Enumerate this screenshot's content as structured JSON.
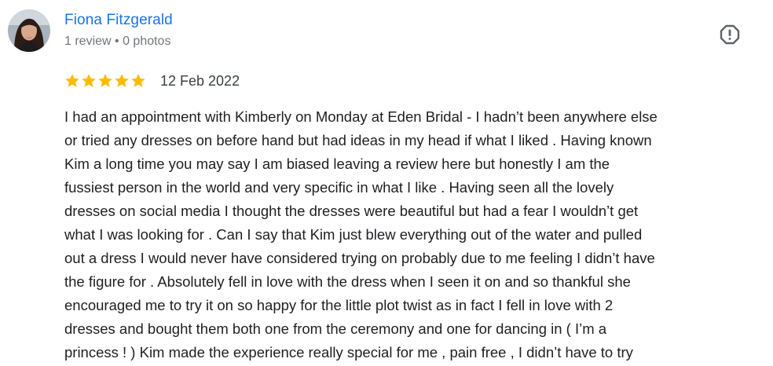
{
  "reviewer": {
    "name": "Fiona Fitzgerald",
    "meta": "1 review • 0 photos"
  },
  "review": {
    "rating": 5,
    "rating_max": 5,
    "date": "12 Feb 2022",
    "lines": [
      "I had an appointment with Kimberly on Monday at Eden Bridal - I hadn’t been anywhere else",
      "or tried any dresses on before hand but had ideas in my head if what I liked . Having known",
      "Kim a long time you may say I am biased leaving a review here but honestly I am the",
      "fussiest person in the world and very specific in what I like . Having seen all the lovely",
      "dresses on social media I thought the dresses were beautiful but had a fear I wouldn’t get",
      "what I was looking for . Can I say that Kim just blew everything out of the water and pulled",
      "out a dress I would never have considered trying on probably due to me feeling I didn’t have",
      "the figure for . Absolutely fell in love with the dress when I seen it on and so thankful she",
      "encouraged me to try it on so happy for the little plot twist as in fact I fell in love with 2",
      "dresses and bought them both one from the ceremony and one for dancing in ( I’m a",
      "princess ! ) Kim made the experience really special for me , pain free , I didn’t have to try"
    ]
  },
  "icons": {
    "flag": "report-flag-icon",
    "star": "star-icon",
    "avatar": "avatar"
  },
  "colors": {
    "name_link": "#1a73e8",
    "meta_text": "#70757a",
    "star": "#fbbc04",
    "body_text": "#202124",
    "flag_icon": "#5f6368"
  }
}
